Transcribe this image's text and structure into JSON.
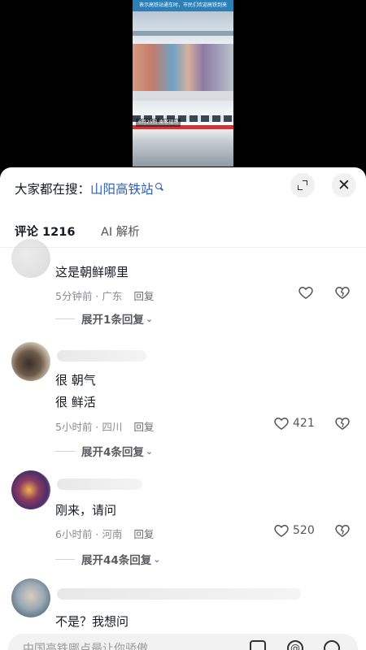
{
  "video": {
    "caption": "表示高铁站通车时，市民们欢迎高铁到来",
    "stamp": "6月25日 乘客现场"
  },
  "sheet": {
    "search_prefix": "大家都在搜：",
    "search_term": "山阳高铁站",
    "tabs": [
      {
        "label": "评论 1216"
      },
      {
        "label": "AI 解析"
      }
    ],
    "close_glyph": "✕"
  },
  "comments": [
    {
      "lines": [
        "这是朝鲜哪里"
      ],
      "time": "5分钟前 · 广东",
      "reply_label": "回复",
      "likes": "",
      "thread": "展开1条回复"
    },
    {
      "lines": [
        "很 朝气",
        "很 鲜活"
      ],
      "time": "5小时前 · 四川",
      "reply_label": "回复",
      "likes": "421",
      "thread": "展开4条回复"
    },
    {
      "lines": [
        "刚来，请问"
      ],
      "time": "6小时前 · 河南",
      "reply_label": "回复",
      "likes": "520",
      "thread": "展开44条回复"
    },
    {
      "lines": [
        "不是？我想问"
      ],
      "time": "",
      "reply_label": "",
      "likes": "",
      "thread": ""
    }
  ],
  "input": {
    "placeholder": "中国高铁哪点最让你骄傲",
    "at_glyph": "@"
  },
  "colors": {
    "search_term": "#2b5fb8",
    "sheet_bg": "#ffffff",
    "input_bg": "#f2f2f3"
  }
}
